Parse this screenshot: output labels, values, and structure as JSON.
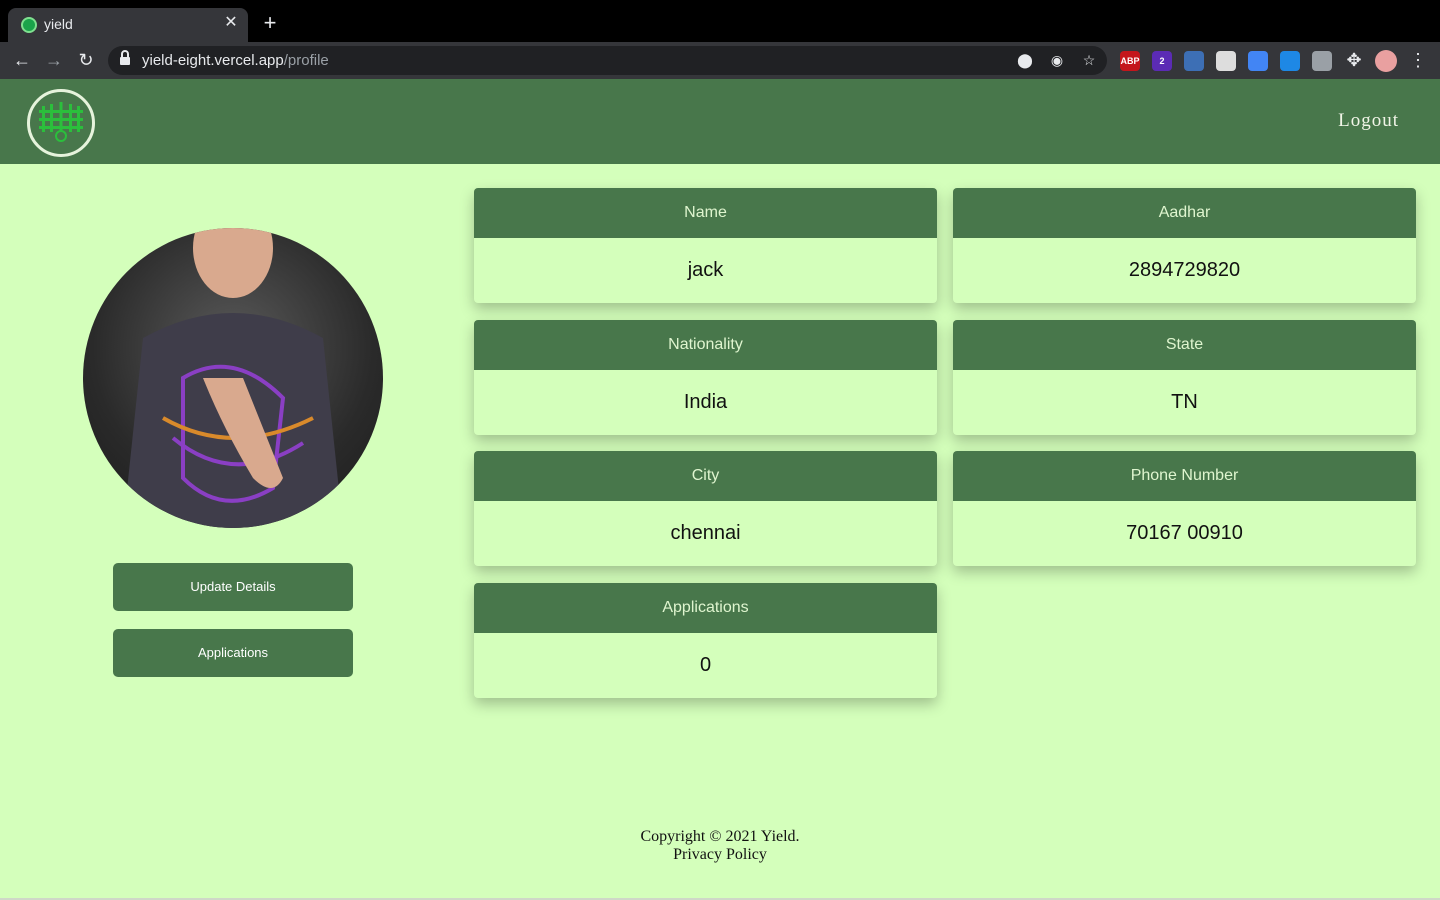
{
  "browser": {
    "tab_title": "yield",
    "tab_close": "✕",
    "new_tab": "+",
    "url_host": "yield-eight.vercel.app",
    "url_path": "/profile",
    "extensions": [
      {
        "name": "adblock-icon",
        "label": "ABP",
        "color": "#c4161c"
      },
      {
        "name": "extension-badge-icon",
        "label": "2",
        "color": "#5b2bb5"
      },
      {
        "name": "eyes-extension-icon",
        "label": "",
        "color": "#3d6fb5"
      },
      {
        "name": "screenshot-extension-icon",
        "label": "",
        "color": "#dddddd"
      },
      {
        "name": "pen-extension-icon",
        "label": "",
        "color": "#4285f4"
      },
      {
        "name": "react-devtools-icon",
        "label": "",
        "color": "#1e88e5"
      },
      {
        "name": "vue-devtools-icon",
        "label": "",
        "color": "#9aa0a6"
      }
    ]
  },
  "header": {
    "logout_label": "Logout"
  },
  "profile": {
    "buttons": {
      "update_label": "Update Details",
      "applications_label": "Applications"
    },
    "cards": [
      {
        "label": "Name",
        "value": "jack"
      },
      {
        "label": "Aadhar",
        "value": "2894729820"
      },
      {
        "label": "Nationality",
        "value": "India"
      },
      {
        "label": "State",
        "value": "TN"
      },
      {
        "label": "City",
        "value": "chennai"
      },
      {
        "label": "Phone Number",
        "value": "70167 00910"
      },
      {
        "label": "Applications",
        "value": "0"
      }
    ]
  },
  "footer": {
    "copyright": "Copyright © 2021 Yield.",
    "privacy": "Privacy Policy"
  },
  "colors": {
    "page_bg": "#d4ffbb",
    "brand_green": "#48774b"
  }
}
